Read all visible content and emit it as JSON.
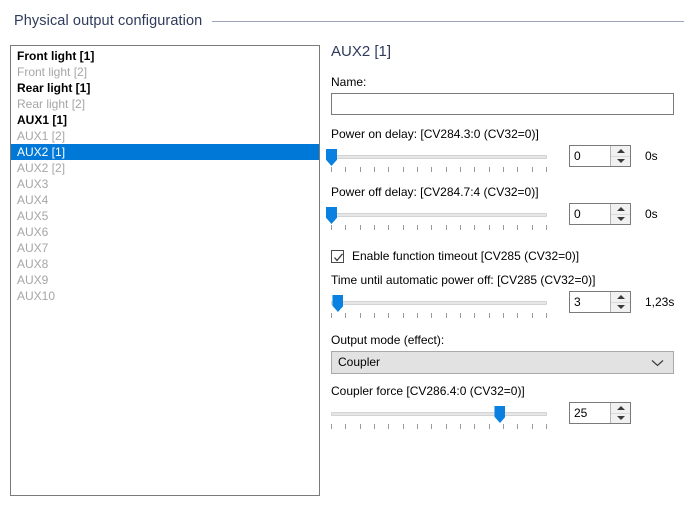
{
  "group": {
    "title": "Physical output configuration"
  },
  "outputs_list": {
    "name": "physical-output-list",
    "items": [
      {
        "label": "Front light [1]",
        "state": "enabled",
        "selected": false
      },
      {
        "label": "Front light [2]",
        "state": "disabled",
        "selected": false
      },
      {
        "label": "Rear light [1]",
        "state": "enabled",
        "selected": false
      },
      {
        "label": "Rear light [2]",
        "state": "disabled",
        "selected": false
      },
      {
        "label": "AUX1 [1]",
        "state": "enabled",
        "selected": false
      },
      {
        "label": "AUX1 [2]",
        "state": "disabled",
        "selected": false
      },
      {
        "label": "AUX2 [1]",
        "state": "enabled",
        "selected": true
      },
      {
        "label": "AUX2 [2]",
        "state": "disabled",
        "selected": false
      },
      {
        "label": "AUX3",
        "state": "disabled",
        "selected": false
      },
      {
        "label": "AUX4",
        "state": "disabled",
        "selected": false
      },
      {
        "label": "AUX5",
        "state": "disabled",
        "selected": false
      },
      {
        "label": "AUX6",
        "state": "disabled",
        "selected": false
      },
      {
        "label": "AUX7",
        "state": "disabled",
        "selected": false
      },
      {
        "label": "AUX8",
        "state": "disabled",
        "selected": false
      },
      {
        "label": "AUX9",
        "state": "disabled",
        "selected": false
      },
      {
        "label": "AUX10",
        "state": "disabled",
        "selected": false
      }
    ]
  },
  "detail": {
    "title": "AUX2 [1]",
    "name_label": "Name:",
    "name_value": "",
    "name_placeholder": "",
    "power_on_delay": {
      "label": "Power on delay: [CV284.3:0 (CV32=0)]",
      "value": "0",
      "suffix": "0s",
      "slider_percent": 0,
      "tick_count": 16
    },
    "power_off_delay": {
      "label": "Power off delay: [CV284.7:4 (CV32=0)]",
      "value": "0",
      "suffix": "0s",
      "slider_percent": 0,
      "tick_count": 16
    },
    "enable_timeout": {
      "label": "Enable function timeout [CV285 (CV32=0)]",
      "checked": true
    },
    "auto_power_off": {
      "label": "Time until automatic power off: [CV285 (CV32=0)]",
      "value": "3",
      "suffix": "1,23s",
      "slider_percent": 3,
      "tick_count": 16
    },
    "output_mode": {
      "label": "Output mode (effect):",
      "value": "Coupler"
    },
    "coupler_force": {
      "label": "Coupler force [CV286.4:0 (CV32=0)]",
      "value": "25",
      "suffix": "",
      "slider_percent": 78,
      "tick_count": 16
    }
  },
  "colors": {
    "accent": "#0078d7",
    "slider_blue": "#0a81e0",
    "header_navy": "#2f3b5c",
    "disabled_text": "#a6a6a6"
  }
}
